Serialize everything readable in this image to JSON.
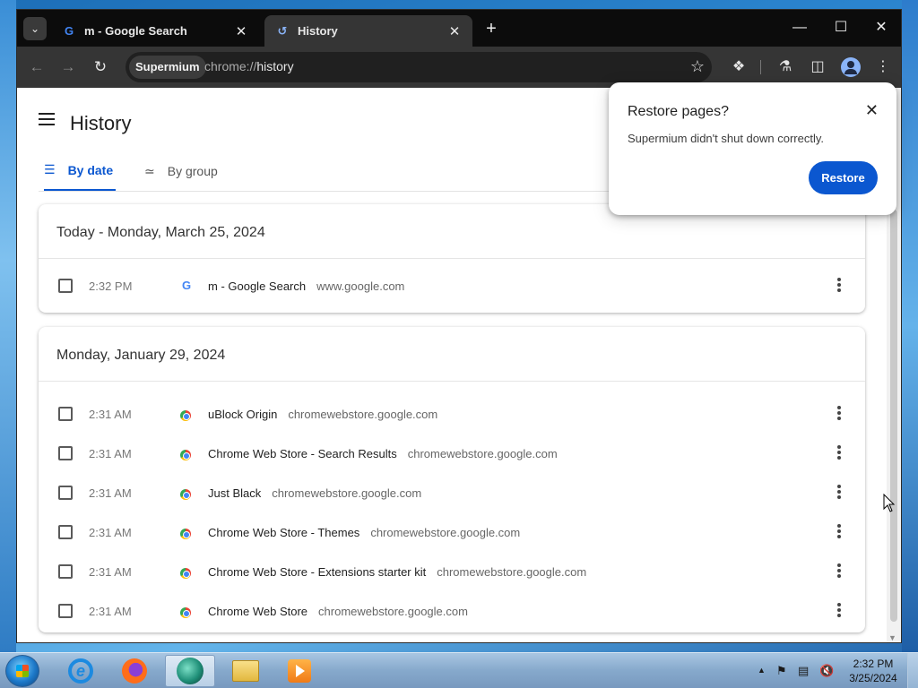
{
  "browser": {
    "tabs": [
      {
        "title": "m - Google Search",
        "favicon": "google-g-icon",
        "active": false
      },
      {
        "title": "History",
        "favicon": "history-icon",
        "active": true
      }
    ],
    "toolbar": {
      "chip_label": "Supermium",
      "url_scheme": "chrome://",
      "url_host": "history"
    }
  },
  "history_page": {
    "title": "History",
    "tabs": [
      {
        "label": "By date",
        "icon": "list-icon",
        "selected": true
      },
      {
        "label": "By group",
        "icon": "group-icon",
        "selected": false
      }
    ],
    "groups": [
      {
        "header": "Today - Monday, March 25, 2024",
        "entries": [
          {
            "time": "2:32 PM",
            "title": "m - Google Search",
            "domain": "www.google.com",
            "favicon": "google-g-icon"
          }
        ]
      },
      {
        "header": "Monday, January 29, 2024",
        "entries": [
          {
            "time": "2:31 AM",
            "title": "uBlock Origin",
            "domain": "chromewebstore.google.com",
            "favicon": "chrome-web-store-icon"
          },
          {
            "time": "2:31 AM",
            "title": "Chrome Web Store - Search Results",
            "domain": "chromewebstore.google.com",
            "favicon": "chrome-web-store-icon"
          },
          {
            "time": "2:31 AM",
            "title": "Just Black",
            "domain": "chromewebstore.google.com",
            "favicon": "chrome-web-store-icon"
          },
          {
            "time": "2:31 AM",
            "title": "Chrome Web Store - Themes",
            "domain": "chromewebstore.google.com",
            "favicon": "chrome-web-store-icon"
          },
          {
            "time": "2:31 AM",
            "title": "Chrome Web Store - Extensions starter kit",
            "domain": "chromewebstore.google.com",
            "favicon": "chrome-web-store-icon"
          },
          {
            "time": "2:31 AM",
            "title": "Chrome Web Store",
            "domain": "chromewebstore.google.com",
            "favicon": "chrome-web-store-icon"
          }
        ]
      }
    ]
  },
  "restore_popup": {
    "title": "Restore pages?",
    "message": "Supermium didn't shut down correctly.",
    "button_label": "Restore"
  },
  "taskbar": {
    "clock_time": "2:32 PM",
    "clock_date": "3/25/2024",
    "pinned": [
      "internet-explorer-icon",
      "firefox-icon",
      "supermium-icon",
      "file-explorer-icon",
      "media-player-icon"
    ]
  },
  "colors": {
    "accent": "#0b57d0",
    "titlebar": "#0c0c0c",
    "toolbar": "#353535"
  }
}
